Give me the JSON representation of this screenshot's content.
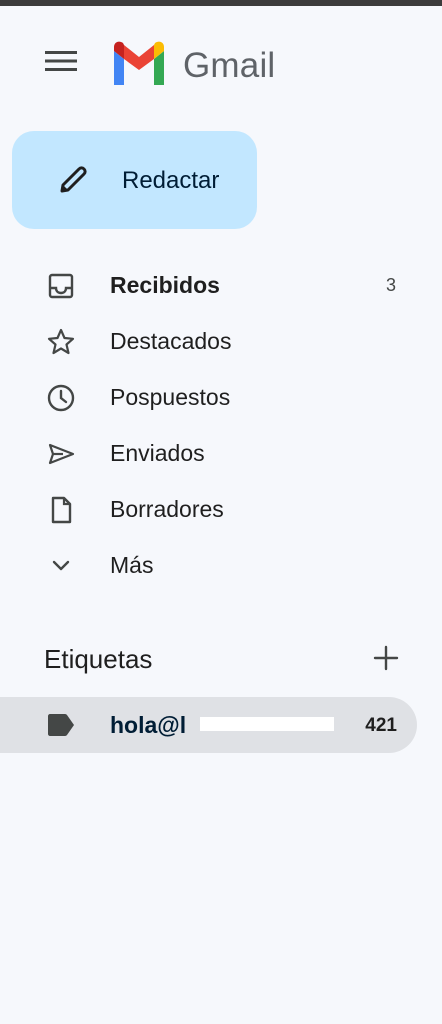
{
  "app": {
    "name": "Gmail"
  },
  "compose": {
    "label": "Redactar"
  },
  "nav": [
    {
      "label": "Recibidos",
      "count": "3",
      "icon": "inbox-icon",
      "bold": true
    },
    {
      "label": "Destacados",
      "count": "",
      "icon": "star-icon"
    },
    {
      "label": "Pospuestos",
      "count": "",
      "icon": "clock-icon"
    },
    {
      "label": "Enviados",
      "count": "",
      "icon": "send-icon"
    },
    {
      "label": "Borradores",
      "count": "",
      "icon": "draft-icon"
    },
    {
      "label": "Más",
      "count": "",
      "icon": "chevron-down-icon"
    }
  ],
  "labels": {
    "title": "Etiquetas",
    "items": [
      {
        "label": "hola@l",
        "count": "421",
        "icon": "label-tag-icon"
      }
    ]
  },
  "colors": {
    "compose_bg": "#c2e7ff",
    "active_label_bg": "#dfe1e5",
    "sidebar_bg": "#f6f8fc"
  }
}
